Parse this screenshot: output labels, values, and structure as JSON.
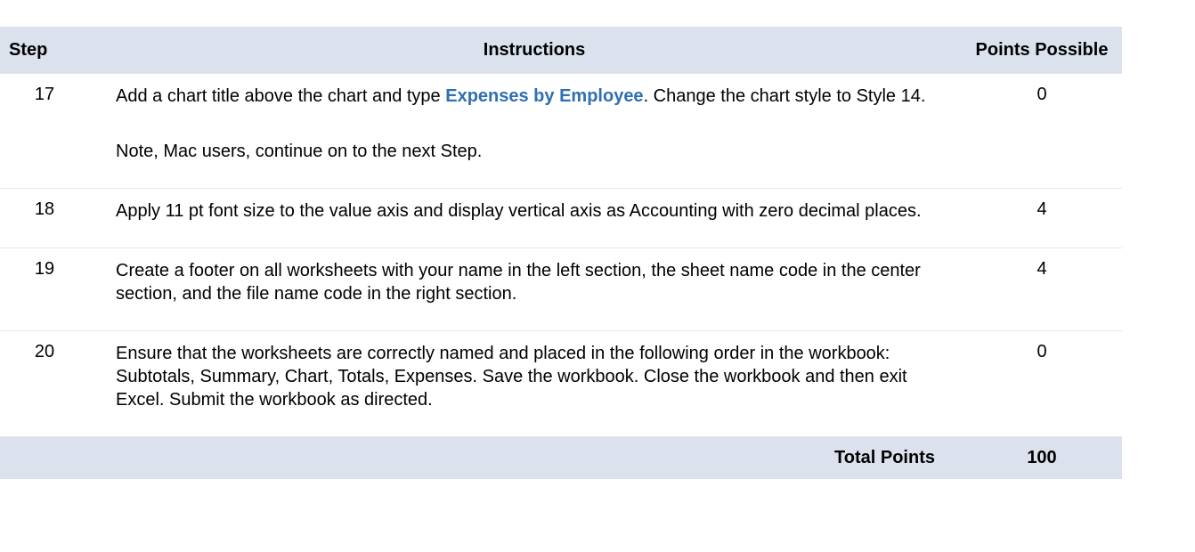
{
  "headers": {
    "step": "Step",
    "instructions": "Instructions",
    "points": "Points Possible"
  },
  "rows": [
    {
      "step": "17",
      "instr_pre": "Add a chart title above the chart and type ",
      "instr_bold": "Expenses by Employee",
      "instr_post": ". Change the chart style to Style 14.",
      "note": "Note, Mac users, continue on to the next Step.",
      "points": "0"
    },
    {
      "step": "18",
      "instr_pre": "Apply 11 pt font size to the value axis and display vertical axis as Accounting with zero decimal places.",
      "instr_bold": "",
      "instr_post": "",
      "note": "",
      "points": "4"
    },
    {
      "step": "19",
      "instr_pre": "Create a footer on all worksheets with your name in the left section, the sheet name code in the center section, and the file name code in the right section.",
      "instr_bold": "",
      "instr_post": "",
      "note": "",
      "points": "4"
    },
    {
      "step": "20",
      "instr_pre": "Ensure that the worksheets are correctly named and placed in the following order in the workbook: Subtotals, Summary, Chart, Totals, Expenses. Save the workbook. Close the workbook and then exit Excel. Submit the workbook as directed.",
      "instr_bold": "",
      "instr_post": "",
      "note": "",
      "points": "0"
    }
  ],
  "footer": {
    "label": "Total Points",
    "value": "100"
  }
}
